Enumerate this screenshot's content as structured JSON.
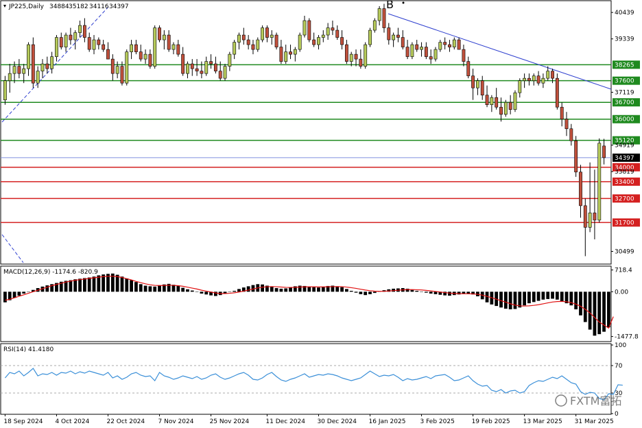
{
  "chart_data": {
    "type": "candlestick",
    "symbol": "JP225,Daily",
    "ohlc_header": [
      "34884",
      "35182",
      "34116",
      "34397"
    ],
    "annotation": "B",
    "watermark": "FXTM富拓",
    "colors": {
      "bull_body": "#b5c95a",
      "bear_body": "#c0503c",
      "wick": "#000000",
      "support_line": "#1f8a1f",
      "resistance_line": "#d42020",
      "trend_line": "#2e3fcf",
      "price_line": "#7f8fdf",
      "macd_hist": "#000000",
      "macd_signal": "#e01010",
      "rsi_line": "#3a8fd8"
    },
    "price_axis": {
      "ylim": [
        30000,
        40900
      ],
      "ticks": [
        "40439",
        "39339",
        "38265",
        "37600",
        "37119",
        "36700",
        "36000",
        "35120",
        "34919",
        "34397",
        "34000",
        "33819",
        "33400",
        "32700",
        "31700",
        "30499"
      ]
    },
    "horizontal_levels": [
      {
        "value": 38265,
        "label": "38265",
        "kind": "support"
      },
      {
        "value": 37600,
        "label": "37600",
        "kind": "support"
      },
      {
        "value": 36700,
        "label": "36700",
        "kind": "support"
      },
      {
        "value": 36000,
        "label": "36000",
        "kind": "support"
      },
      {
        "value": 35120,
        "label": "35120",
        "kind": "support"
      },
      {
        "value": 34000,
        "label": "34000",
        "kind": "resistance"
      },
      {
        "value": 33400,
        "label": "33400",
        "kind": "resistance"
      },
      {
        "value": 32700,
        "label": "32700",
        "kind": "resistance"
      },
      {
        "value": 31700,
        "label": "31700",
        "kind": "resistance"
      }
    ],
    "current_price": {
      "value": 34397,
      "label": "34397"
    },
    "candles": [
      [
        36800,
        37800,
        36600,
        37600
      ],
      [
        37600,
        38300,
        37100,
        37900
      ],
      [
        37900,
        38400,
        37500,
        38200
      ],
      [
        38200,
        38500,
        37700,
        37900
      ],
      [
        37900,
        38300,
        37500,
        38100
      ],
      [
        38100,
        39200,
        37800,
        39100
      ],
      [
        39100,
        39400,
        37300,
        37500
      ],
      [
        37500,
        38200,
        37300,
        38000
      ],
      [
        38000,
        38500,
        37700,
        38300
      ],
      [
        38300,
        38600,
        37900,
        38100
      ],
      [
        38100,
        38800,
        37900,
        38600
      ],
      [
        38600,
        39500,
        38400,
        39400
      ],
      [
        39400,
        39600,
        38900,
        39000
      ],
      [
        39000,
        39600,
        38800,
        39500
      ],
      [
        39500,
        39800,
        39100,
        39300
      ],
      [
        39300,
        39700,
        38900,
        39600
      ],
      [
        39600,
        40100,
        39400,
        39900
      ],
      [
        39900,
        40200,
        39200,
        39400
      ],
      [
        39400,
        39600,
        38800,
        38900
      ],
      [
        38900,
        39500,
        38700,
        39300
      ],
      [
        39300,
        39400,
        38900,
        39100
      ],
      [
        39100,
        39300,
        38800,
        38900
      ],
      [
        38900,
        39200,
        38600,
        38500
      ],
      [
        38500,
        38700,
        37600,
        37900
      ],
      [
        37900,
        38400,
        37700,
        38200
      ],
      [
        38200,
        38400,
        37400,
        37500
      ],
      [
        37500,
        38900,
        37400,
        38800
      ],
      [
        38800,
        39300,
        38500,
        39100
      ],
      [
        39100,
        39300,
        38700,
        38800
      ],
      [
        38800,
        39100,
        38400,
        38500
      ],
      [
        38500,
        38900,
        38300,
        38700
      ],
      [
        38700,
        38900,
        38100,
        38200
      ],
      [
        38200,
        39900,
        38100,
        39800
      ],
      [
        39800,
        39900,
        39200,
        39300
      ],
      [
        39300,
        39700,
        38900,
        39500
      ],
      [
        39500,
        39700,
        38800,
        38900
      ],
      [
        38900,
        39200,
        38700,
        39100
      ],
      [
        39100,
        39300,
        38600,
        38700
      ],
      [
        38700,
        39000,
        37800,
        37900
      ],
      [
        37900,
        38400,
        37700,
        38300
      ],
      [
        38300,
        38500,
        37800,
        38100
      ],
      [
        38100,
        38500,
        37800,
        38000
      ],
      [
        38000,
        38400,
        37700,
        37900
      ],
      [
        37900,
        38600,
        37800,
        38400
      ],
      [
        38400,
        38700,
        38100,
        38300
      ],
      [
        38300,
        38600,
        37900,
        38000
      ],
      [
        38000,
        38400,
        37600,
        37700
      ],
      [
        37700,
        38300,
        37600,
        38200
      ],
      [
        38200,
        38800,
        38000,
        38700
      ],
      [
        38700,
        39300,
        38500,
        39200
      ],
      [
        39200,
        39600,
        38900,
        39500
      ],
      [
        39500,
        39800,
        39100,
        39300
      ],
      [
        39300,
        39500,
        38900,
        39100
      ],
      [
        39100,
        39300,
        38700,
        38900
      ],
      [
        38900,
        39400,
        38800,
        39300
      ],
      [
        39300,
        39900,
        39200,
        39800
      ],
      [
        39800,
        39900,
        39200,
        39400
      ],
      [
        39400,
        39700,
        39100,
        39500
      ],
      [
        39500,
        39600,
        38900,
        39000
      ],
      [
        39000,
        39300,
        38300,
        38400
      ],
      [
        38400,
        39100,
        38300,
        38800
      ],
      [
        38800,
        39100,
        38500,
        38700
      ],
      [
        38700,
        39000,
        38400,
        38900
      ],
      [
        38900,
        39600,
        38800,
        39500
      ],
      [
        39500,
        40300,
        39400,
        40100
      ],
      [
        40100,
        40200,
        39200,
        39300
      ],
      [
        39300,
        39600,
        39000,
        39100
      ],
      [
        39100,
        39500,
        38900,
        39400
      ],
      [
        39400,
        39700,
        39200,
        39500
      ],
      [
        39500,
        40000,
        39300,
        39800
      ],
      [
        39800,
        40100,
        39500,
        39700
      ],
      [
        39700,
        39900,
        39300,
        39400
      ],
      [
        39400,
        39700,
        38900,
        39100
      ],
      [
        39100,
        39300,
        38300,
        38400
      ],
      [
        38400,
        38800,
        38200,
        38700
      ],
      [
        38700,
        38900,
        38200,
        38500
      ],
      [
        38500,
        38900,
        38100,
        38200
      ],
      [
        38200,
        39200,
        38100,
        39100
      ],
      [
        39100,
        39800,
        39000,
        39700
      ],
      [
        39700,
        40200,
        39600,
        40100
      ],
      [
        40100,
        40700,
        39900,
        40600
      ],
      [
        40600,
        40800,
        39600,
        39800
      ],
      [
        39800,
        40000,
        39100,
        39300
      ],
      [
        39300,
        39600,
        39000,
        39500
      ],
      [
        39500,
        39800,
        39200,
        39400
      ],
      [
        39400,
        39700,
        38900,
        39000
      ],
      [
        39000,
        39300,
        38500,
        38600
      ],
      [
        38600,
        39200,
        38500,
        39100
      ],
      [
        39100,
        39300,
        38800,
        38900
      ],
      [
        38900,
        39200,
        38600,
        39000
      ],
      [
        39000,
        39200,
        38500,
        38600
      ],
      [
        38600,
        38900,
        38300,
        38500
      ],
      [
        38500,
        39000,
        38400,
        38900
      ],
      [
        38900,
        39300,
        38800,
        39200
      ],
      [
        39200,
        39400,
        38900,
        39100
      ],
      [
        39100,
        39300,
        38800,
        39000
      ],
      [
        39000,
        39400,
        38900,
        39300
      ],
      [
        39300,
        39400,
        38900,
        38900
      ],
      [
        38900,
        39100,
        38200,
        38400
      ],
      [
        38400,
        38600,
        37700,
        37800
      ],
      [
        37800,
        38100,
        36800,
        37300
      ],
      [
        37300,
        37700,
        37000,
        37600
      ],
      [
        37600,
        37800,
        36800,
        37000
      ],
      [
        37000,
        37400,
        36500,
        36600
      ],
      [
        36600,
        37000,
        36300,
        36900
      ],
      [
        36900,
        37300,
        36400,
        36500
      ],
      [
        36500,
        36900,
        35900,
        36200
      ],
      [
        36200,
        36800,
        36100,
        36700
      ],
      [
        36700,
        37000,
        36200,
        36400
      ],
      [
        36400,
        37200,
        36300,
        37100
      ],
      [
        37100,
        37700,
        36900,
        37600
      ],
      [
        37600,
        37900,
        37300,
        37700
      ],
      [
        37700,
        37900,
        37400,
        37600
      ],
      [
        37600,
        37900,
        37400,
        37800
      ],
      [
        37800,
        38000,
        37400,
        37500
      ],
      [
        37500,
        37900,
        37300,
        37700
      ],
      [
        37700,
        38200,
        37600,
        38000
      ],
      [
        38000,
        38100,
        37500,
        37700
      ],
      [
        37700,
        37900,
        36400,
        36500
      ],
      [
        36500,
        36700,
        35700,
        36000
      ],
      [
        36000,
        36300,
        35300,
        35600
      ],
      [
        35600,
        35800,
        34900,
        35100
      ],
      [
        35100,
        35300,
        33600,
        33800
      ],
      [
        33800,
        34100,
        31900,
        32400
      ],
      [
        32400,
        32700,
        30300,
        31500
      ],
      [
        31500,
        34200,
        31300,
        32100
      ],
      [
        32100,
        33900,
        31000,
        31800
      ],
      [
        31800,
        35200,
        31700,
        35000
      ],
      [
        34884,
        35182,
        34116,
        34397
      ]
    ],
    "macd": {
      "label": "MACD(12,26,9) -1174.6 -820.9",
      "ticks": [
        "718.4",
        "0.00",
        "-1477.8"
      ],
      "ylim": [
        -1600,
        800
      ],
      "histogram": [
        -350,
        -280,
        -200,
        -130,
        -60,
        0,
        60,
        120,
        170,
        210,
        250,
        290,
        330,
        360,
        380,
        410,
        430,
        450,
        470,
        500,
        540,
        570,
        590,
        600,
        560,
        500,
        440,
        380,
        320,
        250,
        200,
        180,
        170,
        200,
        240,
        260,
        230,
        190,
        130,
        80,
        40,
        -10,
        -60,
        -90,
        -120,
        -140,
        -110,
        -60,
        -10,
        30,
        90,
        140,
        180,
        220,
        250,
        240,
        200,
        160,
        120,
        100,
        110,
        140,
        180,
        200,
        190,
        170,
        150,
        140,
        160,
        190,
        200,
        180,
        150,
        90,
        30,
        -30,
        -80,
        -110,
        -80,
        -40,
        10,
        50,
        80,
        100,
        110,
        120,
        100,
        60,
        30,
        0,
        -30,
        -60,
        -80,
        -100,
        -120,
        -130,
        -110,
        -90,
        -70,
        -60,
        -90,
        -150,
        -250,
        -350,
        -420,
        -470,
        -520,
        -560,
        -580,
        -570,
        -520,
        -450,
        -380,
        -340,
        -300,
        -260,
        -240,
        -230,
        -260,
        -310,
        -380,
        -450,
        -580,
        -780,
        -1000,
        -1250,
        -1450,
        -1400,
        -1320,
        -1174.6
      ],
      "signal": [
        -280,
        -250,
        -200,
        -150,
        -100,
        -50,
        0,
        50,
        100,
        150,
        200,
        240,
        280,
        320,
        350,
        380,
        400,
        420,
        440,
        460,
        480,
        500,
        510,
        510,
        500,
        470,
        430,
        390,
        340,
        300,
        260,
        230,
        210,
        205,
        205,
        215,
        210,
        200,
        180,
        150,
        120,
        90,
        50,
        20,
        -10,
        -40,
        -60,
        -60,
        -50,
        -35,
        -10,
        20,
        55,
        90,
        125,
        150,
        165,
        170,
        165,
        155,
        145,
        142,
        147,
        155,
        160,
        163,
        163,
        160,
        160,
        163,
        168,
        170,
        167,
        153,
        134,
        111,
        83,
        56,
        34,
        19,
        13,
        15,
        25,
        37,
        49,
        61,
        69,
        71,
        66,
        59,
        44,
        27,
        9,
        -9,
        -28,
        -45,
        -57,
        -64,
        -67,
        -67,
        -71,
        -84,
        -112,
        -152,
        -198,
        -246,
        -297,
        -343,
        -397,
        -441,
        -467,
        -472,
        -465,
        -450,
        -428,
        -399,
        -367,
        -339,
        -323,
        -318,
        -330,
        -360,
        -410,
        -480,
        -580,
        -700,
        -850,
        -1000,
        -1100,
        -1200,
        -820.9
      ]
    },
    "rsi": {
      "label": "RSI(14) 41.4180",
      "ticks": [
        "100",
        "70",
        "30",
        "0"
      ],
      "levels": [
        70,
        30
      ],
      "values": [
        52,
        60,
        58,
        62,
        55,
        60,
        66,
        55,
        58,
        57,
        60,
        56,
        60,
        59,
        62,
        58,
        61,
        59,
        62,
        60,
        58,
        56,
        60,
        52,
        55,
        50,
        53,
        58,
        60,
        56,
        54,
        55,
        48,
        60,
        55,
        53,
        50,
        52,
        55,
        53,
        51,
        54,
        50,
        52,
        56,
        58,
        53,
        50,
        52,
        55,
        58,
        60,
        56,
        50,
        49,
        52,
        57,
        60,
        54,
        49,
        47,
        50,
        52,
        55,
        58,
        53,
        55,
        57,
        56,
        58,
        57,
        55,
        52,
        50,
        48,
        50,
        52,
        57,
        62,
        58,
        54,
        56,
        55,
        57,
        53,
        48,
        51,
        49,
        50,
        52,
        54,
        51,
        55,
        56,
        57,
        53,
        48,
        49,
        52,
        55,
        48,
        43,
        40,
        41,
        34,
        32,
        35,
        30,
        33,
        34,
        30,
        32,
        41,
        45,
        48,
        47,
        50,
        53,
        51,
        55,
        50,
        45,
        43,
        32,
        28,
        31,
        30,
        22,
        20,
        29,
        28,
        42,
        41.418
      ]
    },
    "x_labels": [
      "18 Sep 2024",
      "4 Oct 2024",
      "22 Oct 2024",
      "7 Nov 2024",
      "25 Nov 2024",
      "11 Dec 2024",
      "30 Dec 2024",
      "16 Jan 2025",
      "3 Feb 2025",
      "19 Feb 2025",
      "13 Mar 2025",
      "31 Mar 2025"
    ]
  }
}
